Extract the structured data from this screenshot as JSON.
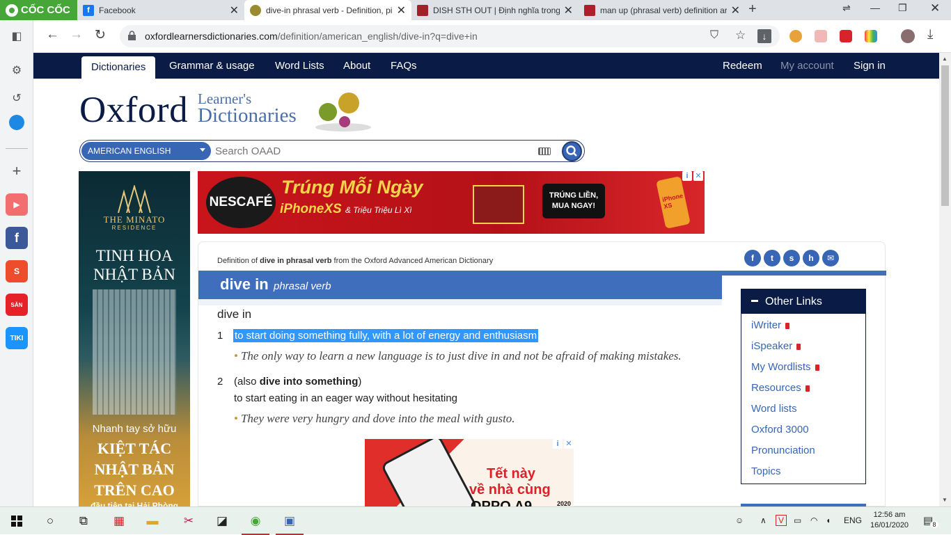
{
  "browser": {
    "brand": "CỐC CỐC",
    "tabs": [
      {
        "title": "Facebook",
        "favicon": "facebook-icon",
        "color": "#1877f2"
      },
      {
        "title": "dive-in phrasal verb - Definition, pi",
        "favicon": "oxford-icon",
        "color": "#9a8a30"
      },
      {
        "title": "DISH STH OUT | Định nghĩa trong",
        "favicon": "cambridge-icon",
        "color": "#a3202a"
      },
      {
        "title": "man up (phrasal verb) definition ar",
        "favicon": "macmillan-icon",
        "color": "#b01e2c"
      }
    ],
    "url_host": "oxfordlearnersdictionaries.com",
    "url_path": "/definition/american_english/dive-in?q=dive+in"
  },
  "site_nav": {
    "items": [
      "Dictionaries",
      "Grammar & usage",
      "Word Lists",
      "About",
      "FAQs"
    ],
    "right": [
      "Redeem",
      "My account",
      "Sign in"
    ]
  },
  "logo": {
    "oxford": "Oxford",
    "learners": "Learner's",
    "dictionaries": "Dictionaries"
  },
  "search": {
    "dictionary": "AMERICAN ENGLISH",
    "placeholder": "Search OAAD"
  },
  "ads": {
    "left": {
      "brand": "THE MINATO",
      "brand_sub": "RESIDENCE",
      "headline": "TINH HOA NHẬT BẢN",
      "pre": "Nhanh tay sở hữu",
      "headline2": "KIỆT TÁC NHẬT BẢN TRÊN CAO",
      "foot": "đầu tiên tại Hải Phòng"
    },
    "top": {
      "brand": "NESCAFÉ",
      "line1": "Trúng Mỗi Ngày",
      "line2": "iPhoneXS",
      "line2_small": "& Triệu Triệu Lì Xì",
      "badge": "TRÚNG LIỀN, MUA NGAY!",
      "phone_label": "iPhone XS"
    },
    "bottom": {
      "line1": "Tết này",
      "line2": "về nhà cùng",
      "line3": "OPPO A9",
      "year": "2020"
    }
  },
  "entry": {
    "source_pre": "Definition of ",
    "source_bold": "dive in phrasal verb",
    "source_post": " from the Oxford Advanced American Dictionary",
    "headword": "dive in",
    "pos": "phrasal verb",
    "phrase": "dive in",
    "senses": [
      {
        "num": "1",
        "def": "to start doing something fully, with a lot of energy and enthusiasm",
        "example": "The only way to learn a new language is to just dive in and not be afraid of making mistakes."
      },
      {
        "num": "2",
        "also_pre": "(also ",
        "also_bold": "dive into something",
        "also_post": ")",
        "def": "to start eating in an eager way without hesitating",
        "example": "They were very hungry and dove into the meal with gusto."
      }
    ],
    "share": [
      "facebook-icon",
      "twitter-icon",
      "stumbleupon-icon",
      "hi5-icon",
      "email-icon"
    ]
  },
  "other_links": {
    "title": "Other Links",
    "items": [
      {
        "label": "iWriter",
        "locked": true
      },
      {
        "label": "iSpeaker",
        "locked": true
      },
      {
        "label": "My Wordlists",
        "locked": true
      },
      {
        "label": "Resources",
        "locked": true
      },
      {
        "label": "Word lists",
        "locked": false
      },
      {
        "label": "Oxford 3000",
        "locked": false
      },
      {
        "label": "Pronunciation",
        "locked": false
      },
      {
        "label": "Topics",
        "locked": false
      }
    ]
  },
  "taskbar": {
    "lang": "ENG",
    "time": "12:56 am",
    "date": "16/01/2020",
    "notifications": "8"
  },
  "colors": {
    "oxford_navy": "#0a1c46",
    "oxford_blue": "#3f6ebd",
    "selection": "#3297fd",
    "coccoc_green": "#46a738"
  }
}
